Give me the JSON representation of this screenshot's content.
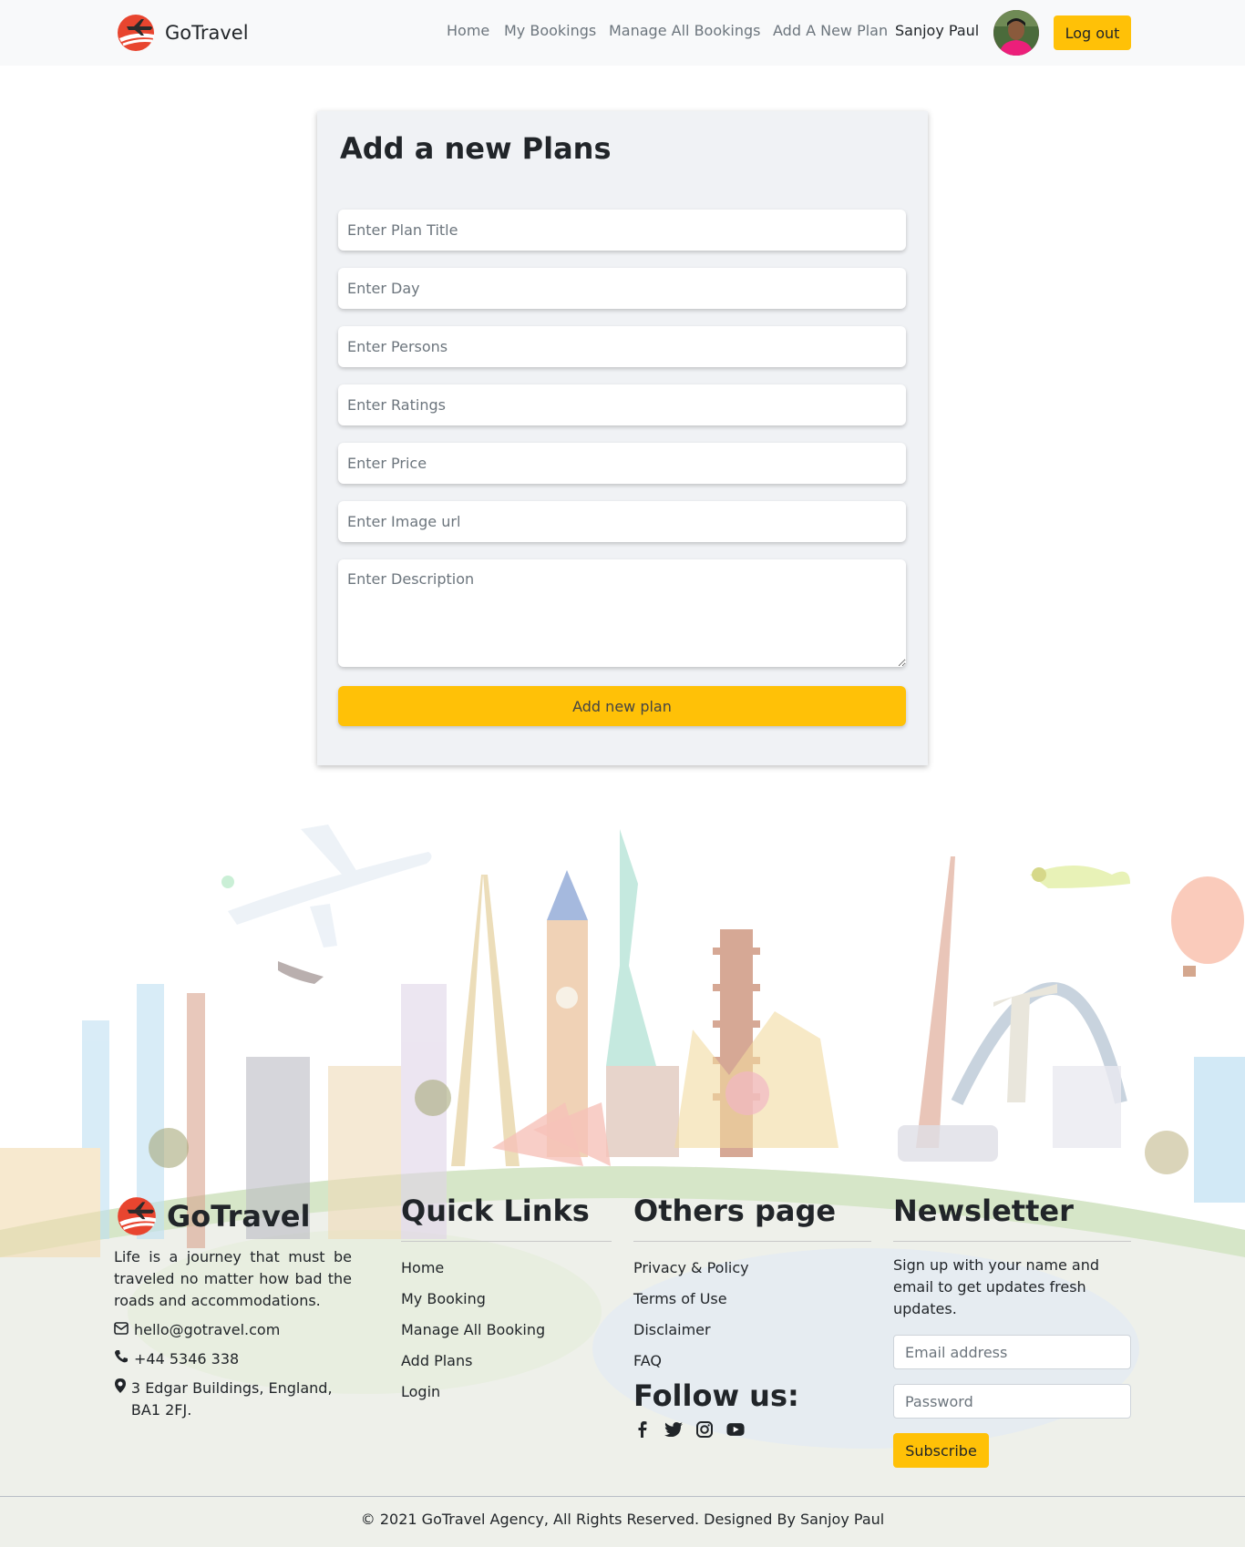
{
  "nav": {
    "brand": "GoTravel",
    "links": [
      "Home",
      "My Bookings",
      "Manage All Bookings",
      "Add A New Plan"
    ],
    "user_name": "Sanjoy Paul",
    "logout_label": "Log out"
  },
  "form": {
    "title": "Add a new Plans",
    "fields": {
      "title_placeholder": "Enter Plan Title",
      "day_placeholder": "Enter Day",
      "persons_placeholder": "Enter Persons",
      "ratings_placeholder": "Enter Ratings",
      "price_placeholder": "Enter Price",
      "image_placeholder": "Enter Image url",
      "description_placeholder": "Enter Description"
    },
    "submit_label": "Add new plan"
  },
  "footer": {
    "brand": "GoTravel",
    "about": "Life is a journey that must be traveled no matter how bad the roads and accommodations.",
    "email": "hello@gotravel.com",
    "phone": "+44 5346 338",
    "address": "3 Edgar Buildings, England, BA1 2FJ.",
    "quick_links": {
      "heading": "Quick Links",
      "items": [
        "Home",
        "My Booking",
        "Manage All Booking",
        "Add Plans",
        "Login"
      ]
    },
    "others": {
      "heading": "Others page",
      "items": [
        "Privacy & Policy",
        "Terms of Use",
        "Disclaimer",
        "FAQ"
      ]
    },
    "follow_heading": "Follow us:",
    "social_icons": [
      "facebook-icon",
      "twitter-icon",
      "instagram-icon",
      "youtube-icon"
    ],
    "newsletter": {
      "heading": "Newsletter",
      "text": "Sign up with your name and email to get updates fresh updates.",
      "email_placeholder": "Email address",
      "password_placeholder": "Password",
      "subscribe_label": "Subscribe"
    },
    "copyright": "© 2021 GoTravel Agency, All Rights Reserved. Designed By Sanjoy Paul"
  },
  "colors": {
    "accent": "#ffc107",
    "navbar_bg": "#f8f9fa",
    "card_bg": "#f0f2f5",
    "logo_red": "#e8452f"
  }
}
